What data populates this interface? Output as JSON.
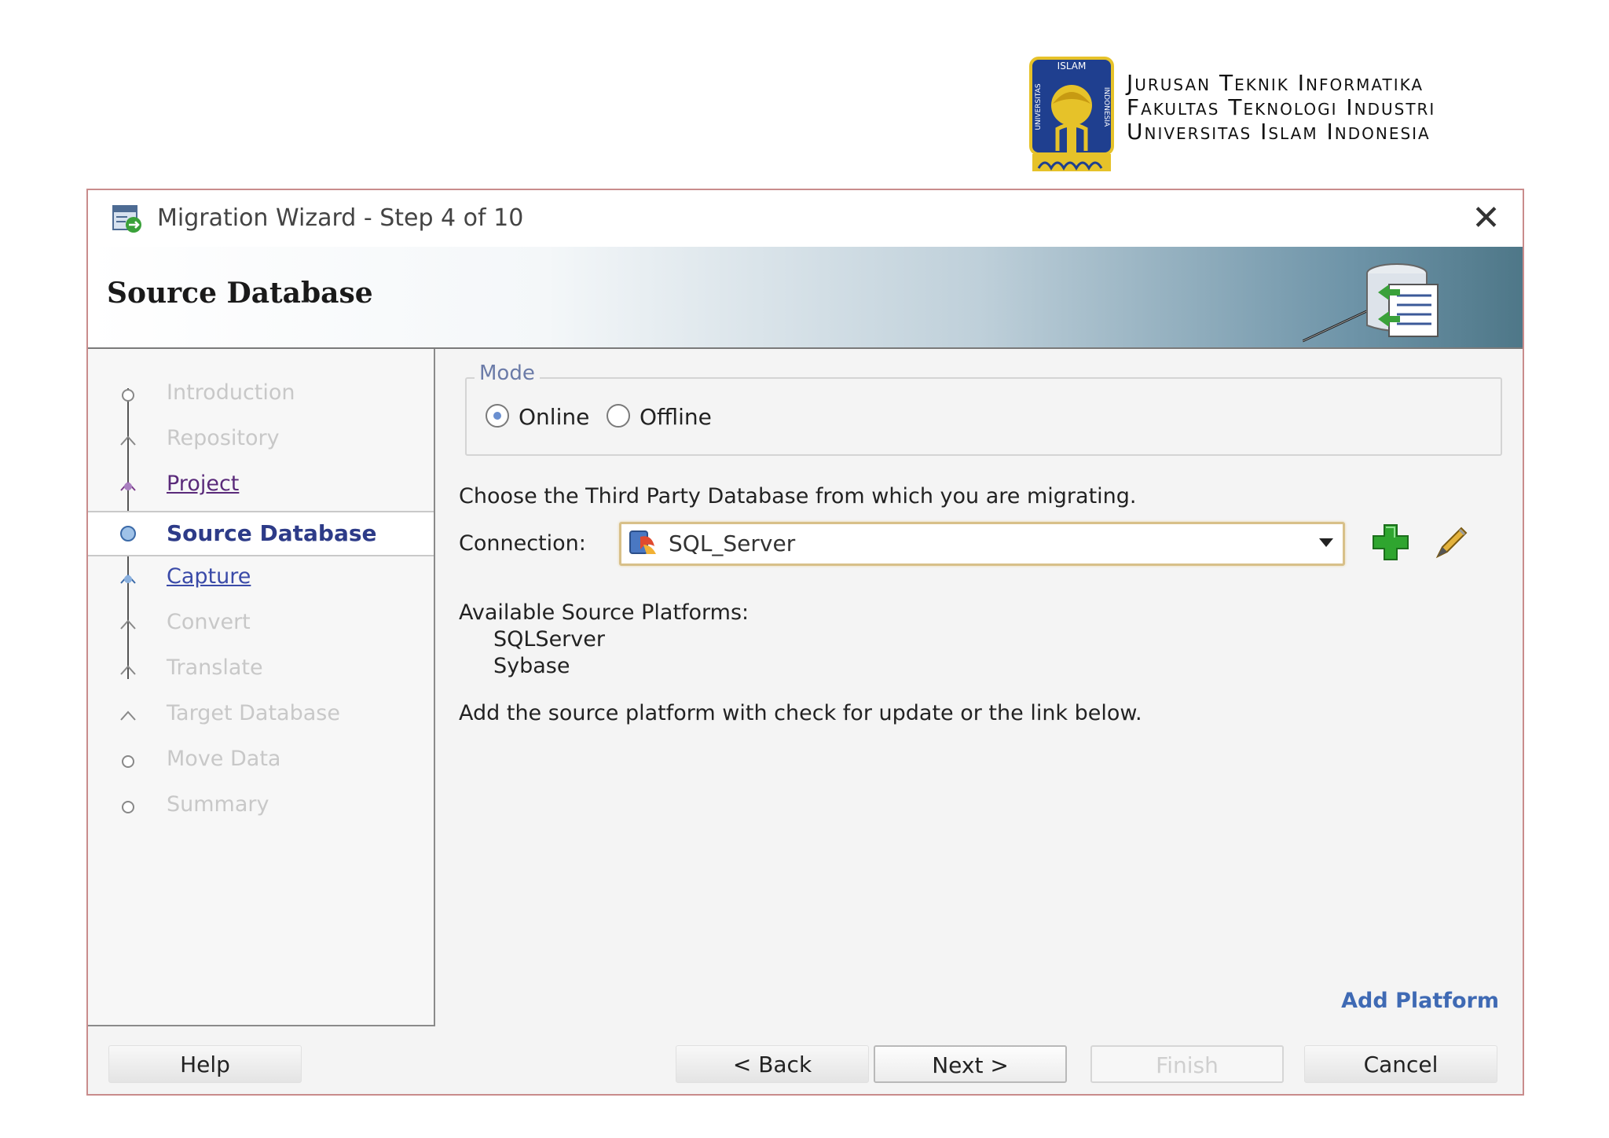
{
  "header": {
    "logo": {
      "top_text": "ISLAM",
      "left_text": "UNIVERSITAS",
      "right_text": "INDONESIA"
    },
    "lines": [
      "Jurusan Teknik Informatika",
      "Fakultas Teknologi Industri",
      "Universitas Islam Indonesia"
    ]
  },
  "dialog": {
    "title": "Migration Wizard - Step 4 of 10",
    "close_icon": "close-icon",
    "banner_title": "Source Database",
    "banner_icon": "database-migrate-icon"
  },
  "steps": [
    {
      "label": "Introduction",
      "state": "disabled"
    },
    {
      "label": "Repository",
      "state": "disabled"
    },
    {
      "label": "Project",
      "state": "visited"
    },
    {
      "label": "Source Database",
      "state": "current"
    },
    {
      "label": "Capture",
      "state": "link"
    },
    {
      "label": "Convert",
      "state": "disabled"
    },
    {
      "label": "Translate",
      "state": "disabled"
    },
    {
      "label": "Target Database",
      "state": "disabled"
    },
    {
      "label": "Move Data",
      "state": "disabled"
    },
    {
      "label": "Summary",
      "state": "disabled"
    }
  ],
  "mode": {
    "legend": "Mode",
    "online_label": "Online",
    "offline_label": "Offline",
    "selected": "Online"
  },
  "content": {
    "instruction": "Choose the Third Party Database from which you are migrating.",
    "connection_label": "Connection:",
    "connection_value": "SQL_Server",
    "available_title": "Available Source Platforms:",
    "platforms": [
      "SQLServer",
      "Sybase"
    ],
    "add_text": "Add the source platform with check for update or the link below.",
    "add_platform_link": "Add Platform"
  },
  "footer": {
    "help": "Help",
    "back": "< Back",
    "next": "Next >",
    "finish": "Finish",
    "cancel": "Cancel"
  },
  "colors": {
    "current_step": "#2d3b88",
    "link": "#3f6ab4",
    "banner_dark": "#4e7788",
    "focus_border": "#d8c089"
  }
}
